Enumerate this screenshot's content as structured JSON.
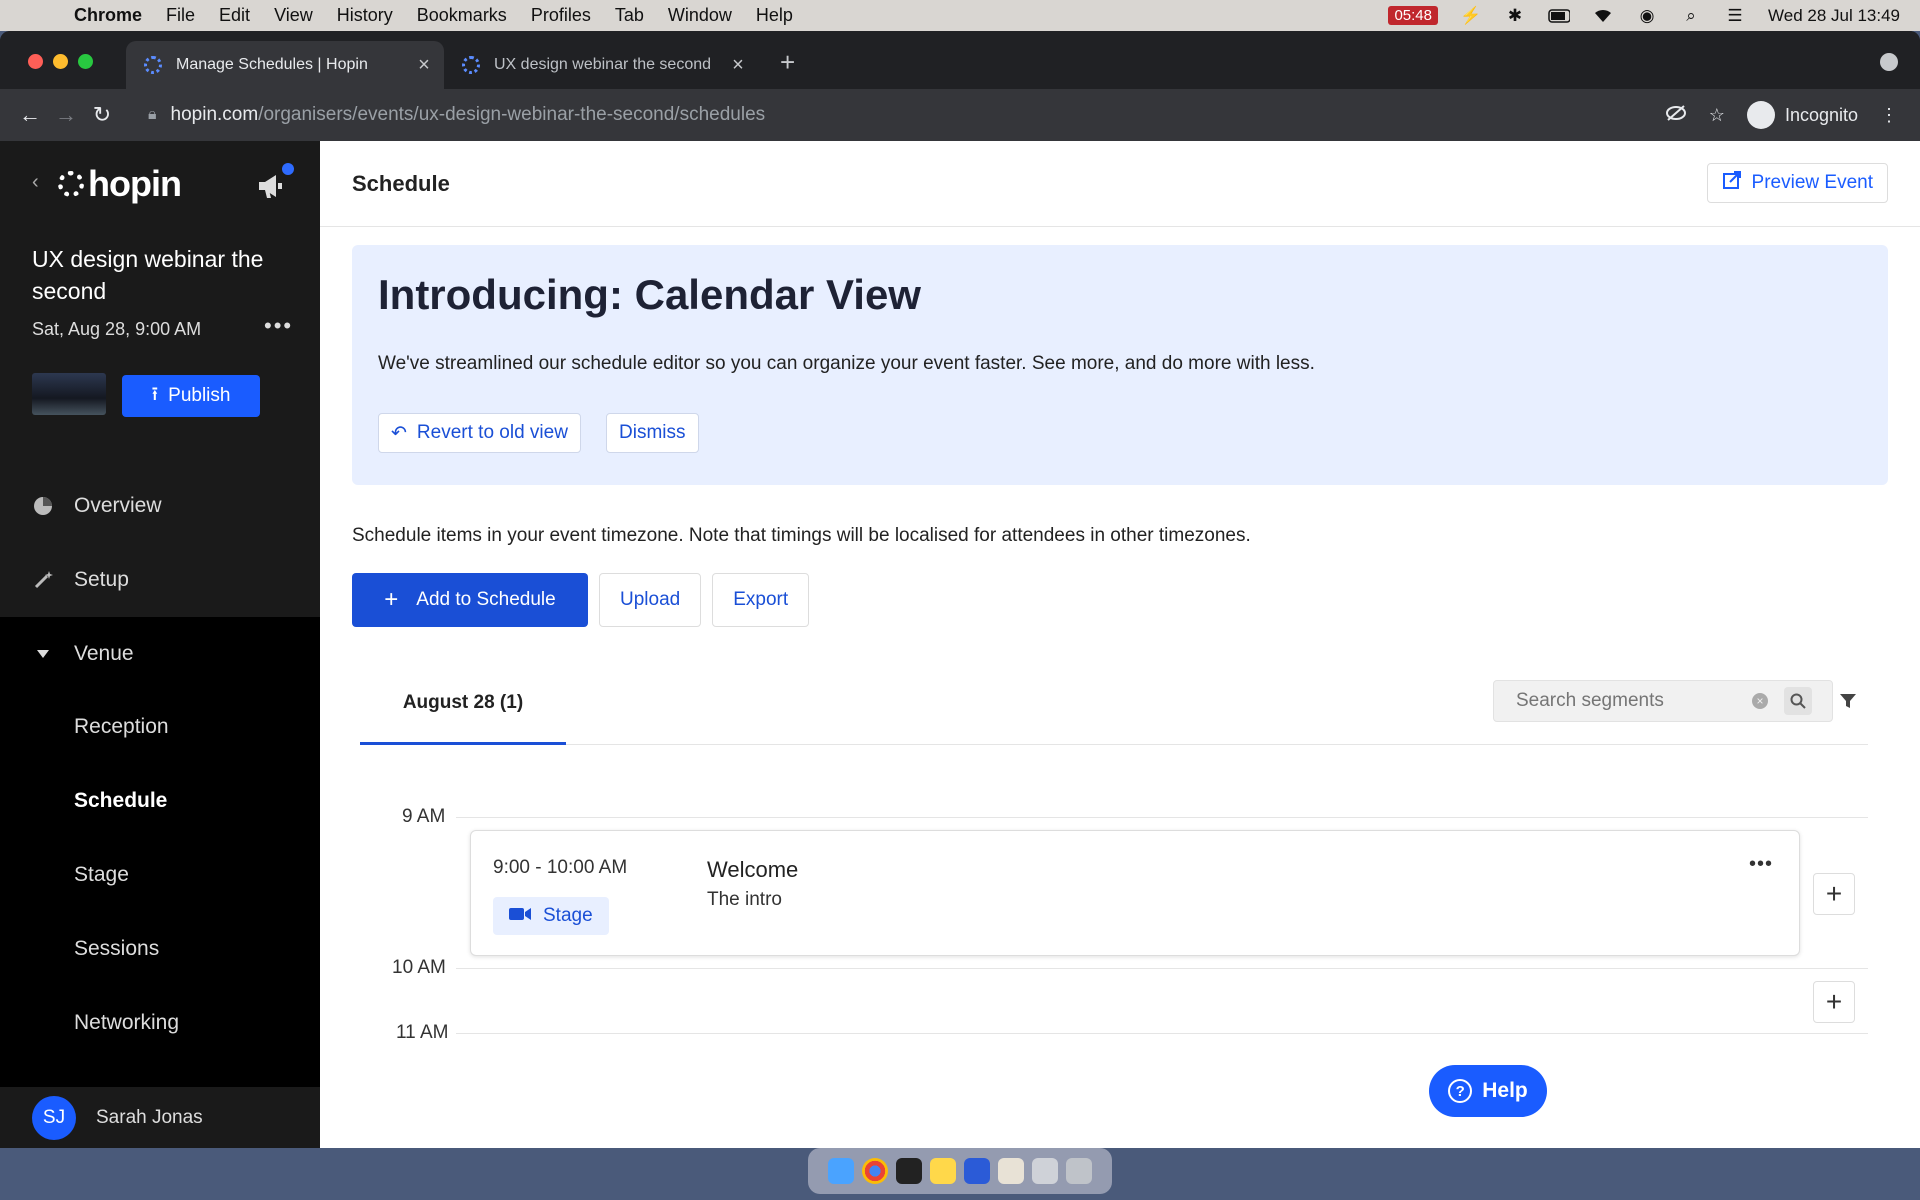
{
  "menubar": {
    "app": "Chrome",
    "items": [
      "File",
      "Edit",
      "View",
      "History",
      "Bookmarks",
      "Profiles",
      "Tab",
      "Window",
      "Help"
    ],
    "recording_time": "05:48",
    "datetime": "Wed 28 Jul  13:49"
  },
  "browser": {
    "tabs": [
      {
        "title": "Manage Schedules | Hopin",
        "active": true
      },
      {
        "title": "UX design webinar the second",
        "active": false
      }
    ],
    "url_host": "hopin.com",
    "url_path": "/organisers/events/ux-design-webinar-the-second/schedules",
    "profile_label": "Incognito"
  },
  "sidebar": {
    "logo": "hopin",
    "event_title": "UX design webinar the second",
    "event_date": "Sat, Aug 28, 9:00 AM",
    "more": "•••",
    "publish_label": "Publish",
    "nav": [
      {
        "label": "Overview",
        "icon": "pie-chart-icon"
      },
      {
        "label": "Setup",
        "icon": "magic-wand-icon"
      },
      {
        "label": "Venue",
        "icon": "caret-down-icon"
      }
    ],
    "venue_items": [
      "Reception",
      "Schedule",
      "Stage",
      "Sessions",
      "Networking"
    ],
    "active_item": "Schedule",
    "user": {
      "initials": "SJ",
      "name": "Sarah Jonas"
    }
  },
  "main": {
    "title": "Schedule",
    "preview_label": "Preview Event",
    "banner": {
      "title": "Introducing: Calendar View",
      "text": "We've streamlined our schedule editor so you can organize your event faster. See more, and do more with less.",
      "revert_label": "Revert to old view",
      "dismiss_label": "Dismiss"
    },
    "timezone_note": "Schedule items in your event timezone. Note that timings will be localised for attendees in other timezones.",
    "actions": {
      "add": "Add to Schedule",
      "upload": "Upload",
      "export": "Export"
    },
    "date_tab": "August 28 (1)",
    "search": {
      "placeholder": "Search segments"
    },
    "time_labels": [
      "9 AM",
      "10 AM",
      "11 AM"
    ],
    "segment": {
      "time": "9:00 - 10:00 AM",
      "venue": "Stage",
      "title": "Welcome",
      "description": "The intro"
    },
    "help_label": "Help"
  },
  "colors": {
    "primary": "#1a4fd6",
    "sidebar_bg": "#1a1a1a",
    "banner_bg": "#e8efff"
  }
}
